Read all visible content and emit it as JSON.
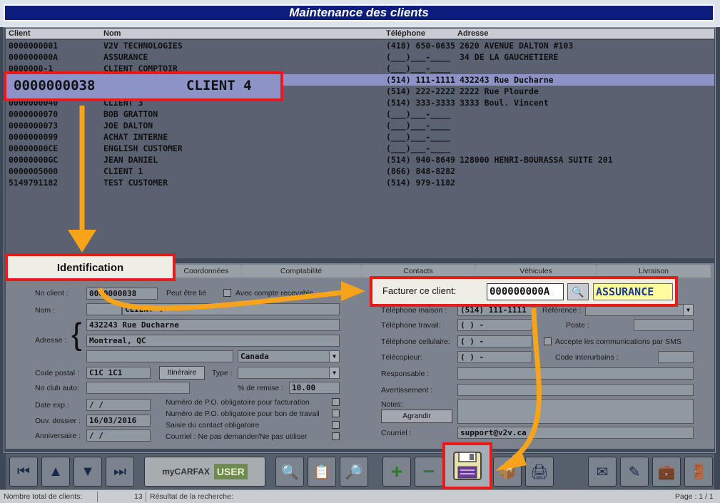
{
  "window": {
    "title": "Maintenance des clients"
  },
  "table": {
    "headers": [
      "Client",
      "Nom",
      "Téléphone",
      "Adresse"
    ],
    "rows": [
      [
        "0000000001",
        "V2V TECHNOLOGIES",
        "(418) 650-0635",
        "2620 AVENUE DALTON #103"
      ],
      [
        "000000000A",
        "ASSURANCE",
        "(___)___-____",
        "34 DE LA GAUCHETIERE"
      ],
      [
        "0000000-1",
        "CLIENT COMPTOIR",
        "(___)___-____",
        ""
      ],
      [
        "",
        "",
        "(514) 111-1111",
        "432243 Rue Ducharne"
      ],
      [
        "",
        "",
        "(514) 222-2222",
        "2222 Rue Plourde"
      ],
      [
        "0000000040",
        "CLIENT 3",
        "(514) 333-3333",
        "3333 Boul. Vincent"
      ],
      [
        "0000000070",
        "BOB GRATTON",
        "(___)___-____",
        ""
      ],
      [
        "0000000073",
        "JOE DALTON",
        "(___)___-____",
        ""
      ],
      [
        "0000000099",
        "ACHAT INTERNE",
        "(___)___-____",
        ""
      ],
      [
        "00000000CE",
        "ENGLISH CUSTOMER",
        "(___)___-____",
        ""
      ],
      [
        "00000000GC",
        "JEAN DANIEL",
        "(514) 940-8649",
        "128000 HENRI-BOURASSA SUITE 201"
      ],
      [
        "0000005000",
        "CLIENT 1",
        "(866) 848-8282",
        ""
      ],
      [
        "5149791182",
        "TEST CUSTOMER",
        "(514) 979-1182",
        ""
      ]
    ]
  },
  "selected": {
    "client": "0000000038",
    "name": "CLIENT 4"
  },
  "tabs": [
    "Identification",
    "Coordonnées",
    "Comptabilité",
    "Contacts",
    "Véhicules",
    "Livraison"
  ],
  "form": {
    "no_client_label": "No client :",
    "no_client": "0000000038",
    "peut_etre_lie": "Peut être lié",
    "avec_compte": "Avec compte recevable",
    "nom_label": "Nom :",
    "nom": "CLIENT 4",
    "adresse_label": "Adresse :",
    "adresse1": "432243 Rue Ducharne",
    "adresse2": "Montreal, QC",
    "adresse3": "",
    "pays": "Canada",
    "code_postal_label": "Code postal :",
    "code_postal": "C1C 1C1",
    "itineraire": "Itinéraire",
    "type_label": "Type :",
    "club_label": "No club auto:",
    "remise_label": "% de remise :",
    "remise": "10.00",
    "date_exp_label": "Date exp.:",
    "date_exp": "/ /",
    "ouv_label": "Ouv. dossier :",
    "ouv": "16/03/2016",
    "anniv_label": "Anniversaire :",
    "anniv": "/ /",
    "po_fact": "Numéro de P.O. obligatoire pour facturation",
    "po_bon": "Numéro de P.O. obligatoire pour bon de travail",
    "saisie": "Saisie du contact obligatoire",
    "courriel_opt": "Courriel : Ne pas demander/Ne pas utiliser",
    "tel_maison_label": "Téléphone maison :",
    "tel_maison": "(514) 111-1111",
    "reference_label": "Référence :",
    "tel_travail_label": "Téléphone travail:",
    "tel_travail": "(   )   -",
    "poste_label": "Poste :",
    "tel_cell_label": "Téléphone cellulaire:",
    "tel_cell": "(   )   -",
    "sms": "Accepte les communications par SMS",
    "telecopieur_label": "Télécopieur:",
    "telecopieur": "(   )   -",
    "code_interurbains_label": "Code interurbains :",
    "responsable_label": "Responsable :",
    "avertissement_label": "Avertissement :",
    "notes_label": "Notes:",
    "agrandir": "Agrandir",
    "courriel_label": "Courriel :",
    "courriel": "support@v2v.ca"
  },
  "facturer": {
    "label": "Facturer ce client:",
    "code": "000000000A",
    "name": "ASSURANCE"
  },
  "toolbar": {
    "carfax": "myCARFAX",
    "user": "USER"
  },
  "status": {
    "total_label": "Nombre total de clients:",
    "total": "13",
    "result_label": "Résultat de la recherche:",
    "page": "Page : 1 / 1"
  },
  "colors": {
    "title_bg": "#0c1d7d",
    "callout_border": "#e61b1b",
    "arrow": "#f7a31c",
    "highlight": "#fffc9e"
  }
}
